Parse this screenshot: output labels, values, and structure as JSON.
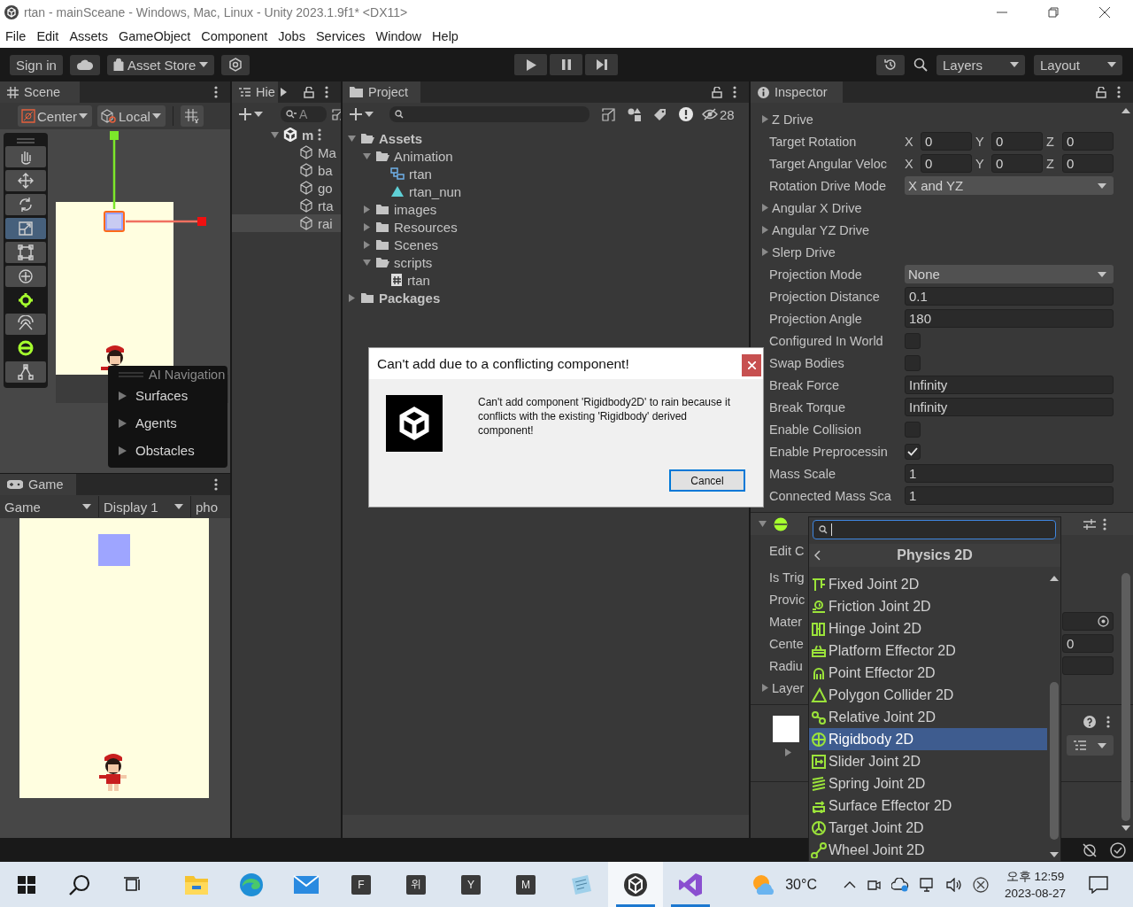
{
  "window": {
    "title": "rtan - mainSceane - Windows, Mac, Linux - Unity 2023.1.9f1* <DX11>"
  },
  "menu": [
    "File",
    "Edit",
    "Assets",
    "GameObject",
    "Component",
    "Jobs",
    "Services",
    "Window",
    "Help"
  ],
  "toolbar": {
    "sign_in": "Sign in",
    "asset_store": "Asset Store",
    "layers": "Layers",
    "layout": "Layout"
  },
  "scene": {
    "tab": "Scene",
    "pivot": "Center",
    "space": "Local",
    "tools": [
      {
        "kind": "hand",
        "selected": false
      },
      {
        "kind": "move",
        "selected": false
      },
      {
        "kind": "rotate",
        "selected": false
      },
      {
        "kind": "scale",
        "selected": true
      },
      {
        "kind": "rect",
        "selected": false
      },
      {
        "kind": "transform",
        "selected": false
      },
      {
        "kind": "light",
        "selected": false
      },
      {
        "kind": "view",
        "selected": false
      },
      {
        "kind": "sphere",
        "selected": false
      },
      {
        "kind": "path",
        "selected": false
      }
    ],
    "overlay": {
      "title": "AI Navigation",
      "items": [
        "Surfaces",
        "Agents",
        "Obstacles"
      ]
    }
  },
  "game": {
    "tab": "Game",
    "mode": "Game",
    "display": "Display 1",
    "aspect": "pho"
  },
  "hierarchy": {
    "tab": "Hie",
    "search_placeholder": "A",
    "scene": {
      "name": "m",
      "expanded": true,
      "children": [
        {
          "name": "Ma",
          "selected": false
        },
        {
          "name": "ba",
          "selected": false
        },
        {
          "name": "go",
          "selected": false
        },
        {
          "name": "rta",
          "selected": false
        },
        {
          "name": "rai",
          "selected": true
        }
      ]
    }
  },
  "project": {
    "tab": "Project",
    "hidden_count": "28",
    "tree": [
      {
        "name": "Assets",
        "kind": "root",
        "expanded": true,
        "children": [
          {
            "name": "Animation",
            "kind": "folder",
            "expanded": true,
            "children": [
              {
                "name": "rtan",
                "kind": "animator"
              },
              {
                "name": "rtan_nun",
                "kind": "clip"
              }
            ]
          },
          {
            "name": "images",
            "kind": "folder",
            "expanded": false
          },
          {
            "name": "Resources",
            "kind": "folder",
            "expanded": false
          },
          {
            "name": "Scenes",
            "kind": "folder",
            "expanded": false
          },
          {
            "name": "scripts",
            "kind": "folder",
            "expanded": true,
            "children": [
              {
                "name": "rtan",
                "kind": "script"
              }
            ]
          }
        ]
      },
      {
        "name": "Packages",
        "kind": "root",
        "expanded": false
      }
    ]
  },
  "inspector": {
    "tab": "Inspector",
    "rows": [
      {
        "kind": "foldout",
        "label": "Z Drive",
        "expanded": false
      },
      {
        "kind": "vector3",
        "label": "Target Rotation",
        "values": [
          {
            "axis": "X",
            "value": "0"
          },
          {
            "axis": "Y",
            "value": "0"
          },
          {
            "axis": "Z",
            "value": "0"
          }
        ]
      },
      {
        "kind": "vector3",
        "label": "Target Angular Veloc",
        "values": [
          {
            "axis": "X",
            "value": "0"
          },
          {
            "axis": "Y",
            "value": "0"
          },
          {
            "axis": "Z",
            "value": "0"
          }
        ]
      },
      {
        "kind": "dropdown",
        "label": "Rotation Drive Mode",
        "value": "X and YZ"
      },
      {
        "kind": "foldout",
        "label": "Angular X Drive",
        "expanded": false
      },
      {
        "kind": "foldout",
        "label": "Angular YZ Drive",
        "expanded": false
      },
      {
        "kind": "foldout",
        "label": "Slerp Drive",
        "expanded": false
      },
      {
        "kind": "dropdown",
        "label": "Projection Mode",
        "value": "None"
      },
      {
        "kind": "field",
        "label": "Projection Distance",
        "value": "0.1"
      },
      {
        "kind": "field",
        "label": "Projection Angle",
        "value": "180"
      },
      {
        "kind": "checkbox",
        "label": "Configured In World",
        "checked": false
      },
      {
        "kind": "checkbox",
        "label": "Swap Bodies",
        "checked": false
      },
      {
        "kind": "field",
        "label": "Break Force",
        "value": "Infinity"
      },
      {
        "kind": "field",
        "label": "Break Torque",
        "value": "Infinity"
      },
      {
        "kind": "checkbox",
        "label": "Enable Collision",
        "checked": false
      },
      {
        "kind": "checkbox",
        "label": "Enable Preprocessin",
        "checked": true
      },
      {
        "kind": "field",
        "label": "Mass Scale",
        "value": "1"
      },
      {
        "kind": "field",
        "label": "Connected Mass Sca",
        "value": "1"
      }
    ],
    "component": {
      "expanded": true,
      "rows": [
        {
          "kind": "label",
          "label": "Edit C"
        },
        {
          "kind": "label",
          "label": "Is Trig"
        },
        {
          "kind": "label",
          "label": "Provic"
        },
        {
          "kind": "object",
          "label": "Mater"
        },
        {
          "kind": "value",
          "label": "Cente",
          "value": "0"
        },
        {
          "kind": "field",
          "label": "Radiu"
        },
        {
          "kind": "foldout",
          "label": "Layer",
          "expanded": false
        }
      ]
    },
    "material": {
      "expanded": false
    }
  },
  "popup": {
    "title": "Physics 2D",
    "items": [
      {
        "kind": "fixed",
        "label": "Fixed Joint 2D",
        "selected": false
      },
      {
        "kind": "friction",
        "label": "Friction Joint 2D",
        "selected": false
      },
      {
        "kind": "hinge",
        "label": "Hinge Joint 2D",
        "selected": false
      },
      {
        "kind": "platform",
        "label": "Platform Effector 2D",
        "selected": false
      },
      {
        "kind": "point",
        "label": "Point Effector 2D",
        "selected": false
      },
      {
        "kind": "polygon",
        "label": "Polygon Collider 2D",
        "selected": false
      },
      {
        "kind": "relative",
        "label": "Relative Joint 2D",
        "selected": false
      },
      {
        "kind": "rigidbody",
        "label": "Rigidbody 2D",
        "selected": true
      },
      {
        "kind": "slider",
        "label": "Slider Joint 2D",
        "selected": false
      },
      {
        "kind": "spring",
        "label": "Spring Joint 2D",
        "selected": false
      },
      {
        "kind": "surface",
        "label": "Surface Effector 2D",
        "selected": false
      },
      {
        "kind": "target",
        "label": "Target Joint 2D",
        "selected": false
      },
      {
        "kind": "wheel",
        "label": "Wheel Joint 2D",
        "selected": false
      }
    ]
  },
  "dialog": {
    "title": "Can't add due to a conflicting component!",
    "message": "Can't add component 'Rigidbody2D' to rain because it conflicts with the existing 'Rigidbody' derived component!",
    "button": "Cancel"
  },
  "taskbar": {
    "apps": [
      {
        "kind": "explorer",
        "running": false,
        "selected": false
      },
      {
        "kind": "edge",
        "running": false,
        "selected": false
      },
      {
        "kind": "mail",
        "running": false,
        "selected": false
      },
      {
        "kind": "tile",
        "label": "F",
        "running": false,
        "selected": false
      },
      {
        "kind": "tile",
        "label": "위",
        "running": false,
        "selected": false
      },
      {
        "kind": "tile",
        "label": "Y",
        "running": false,
        "selected": false
      },
      {
        "kind": "tile",
        "label": "M",
        "running": false,
        "selected": false
      },
      {
        "kind": "notepad",
        "running": false,
        "selected": false
      },
      {
        "kind": "unity",
        "running": true,
        "selected": true
      },
      {
        "kind": "studio",
        "running": true,
        "selected": false
      }
    ],
    "temperature": "30°C",
    "time": "오후 12:59",
    "date": "2023-08-27"
  }
}
